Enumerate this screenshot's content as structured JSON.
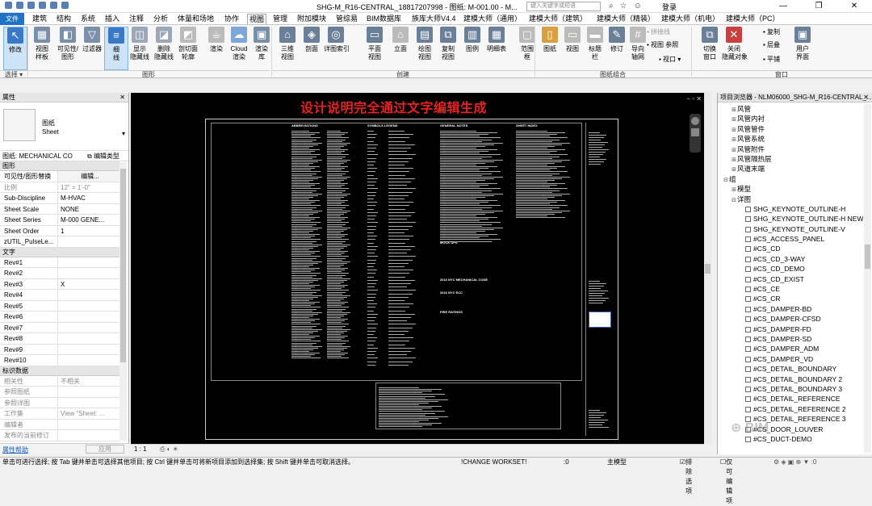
{
  "window": {
    "title": "SHG-M_R16-CENTRAL_18817207998 - 图纸: M-001.00 - M...",
    "search_placeholder": "键入关键字或短语",
    "login": "登录",
    "controls": [
      "—",
      "❐",
      "✕"
    ]
  },
  "tabs": [
    "建筑",
    "结构",
    "系统",
    "插入",
    "注释",
    "分析",
    "体量和场地",
    "协作",
    "视图",
    "管理",
    "附加模块",
    "管综易",
    "BIM数据库",
    "族库大师V4.4",
    "建模大师（通用）",
    "建模大师（建筑）",
    "建模大师（精装）",
    "建模大师（机电）",
    "建模大师（PC）"
  ],
  "active_tab": "视图",
  "file_tab": "文件",
  "ribbon": {
    "buttons": [
      {
        "label": "修改",
        "color": "#3a78c8",
        "glyph": "↖"
      },
      {
        "label": "视图\n样板",
        "color": "#7a8fa8",
        "glyph": "▦"
      },
      {
        "label": "可见性/\n图形",
        "color": "#7a8fa8",
        "glyph": "◧"
      },
      {
        "label": "过滤器",
        "color": "#7a8fa8",
        "glyph": "▽"
      },
      {
        "label": "细\n线",
        "color": "#3a78c8",
        "glyph": "≡"
      },
      {
        "label": "显示\n隐藏线",
        "color": "#9aa8b8",
        "glyph": "◫"
      },
      {
        "label": "删除\n隐藏线",
        "color": "#9aa8b8",
        "glyph": "◪"
      },
      {
        "label": "剖切面\n轮廓",
        "color": "#bbbbbb",
        "glyph": "◩"
      },
      {
        "label": "渲染",
        "color": "#bbbbbb",
        "glyph": "☕"
      },
      {
        "label": "Cloud\n渲染",
        "color": "#7ea6d8",
        "glyph": "☁"
      },
      {
        "label": "渲染\n库",
        "color": "#7a8fa8",
        "glyph": "▣"
      },
      {
        "label": "三维\n视图",
        "color": "#6a7f98",
        "glyph": "⌂"
      },
      {
        "label": "剖面",
        "color": "#6a7f98",
        "glyph": "◈"
      },
      {
        "label": "详图索引",
        "color": "#6a7f98",
        "glyph": "◎"
      },
      {
        "label": "平面\n视图",
        "color": "#6a7f98",
        "glyph": "▭"
      },
      {
        "label": "立面",
        "color": "#bbbbbb",
        "glyph": "⌂"
      },
      {
        "label": "绘图\n视图",
        "color": "#6a7f98",
        "glyph": "▤"
      },
      {
        "label": "复制\n视图",
        "color": "#6a7f98",
        "glyph": "⧉"
      },
      {
        "label": "图例",
        "color": "#6a7f98",
        "glyph": "▥"
      },
      {
        "label": "明细表",
        "color": "#6a7f98",
        "glyph": "▦"
      },
      {
        "label": "范围\n框",
        "color": "#bbbbbb",
        "glyph": "▢"
      },
      {
        "label": "图纸",
        "color": "#d8a040",
        "glyph": "▯"
      },
      {
        "label": "视图",
        "color": "#bbbbbb",
        "glyph": "▭"
      },
      {
        "label": "标题\n栏",
        "color": "#bbbbbb",
        "glyph": "▬"
      },
      {
        "label": "修订",
        "color": "#6a7f98",
        "glyph": "✎"
      },
      {
        "label": "导向\n轴网",
        "color": "#bbbbbb",
        "glyph": "#"
      },
      {
        "label": "切换\n窗口",
        "color": "#6a7f98",
        "glyph": "⧉"
      },
      {
        "label": "关闭\n隐藏对象",
        "color": "#c84040",
        "glyph": "✕"
      },
      {
        "label": "用户\n界面",
        "color": "#6a7f98",
        "glyph": "▣"
      }
    ],
    "small_buttons": [
      "拼接线",
      "视图 参照",
      "视口 ▾",
      "复制",
      "层叠",
      "平铺"
    ],
    "groups": [
      "选择 ▾",
      "图形",
      "创建",
      "图纸组合",
      "窗口"
    ]
  },
  "properties": {
    "header": "属性",
    "type_name": "图纸\nSheet",
    "type_selector": "图纸: MECHANICAL CO",
    "edit_type": "编辑类型",
    "sections": [
      {
        "title": "图形",
        "rows": [
          {
            "k": "可见性/图形替换",
            "v": "编辑...",
            "grey": false
          },
          {
            "k": "比例",
            "v": "12\" = 1'-0\"",
            "grey": true
          },
          {
            "k": "Sub-Discipline",
            "v": "M-HVAC",
            "grey": false
          },
          {
            "k": "Sheet Scale",
            "v": "NONE",
            "grey": false
          },
          {
            "k": "Sheet Series",
            "v": "M-000 GENE...",
            "grey": false
          },
          {
            "k": "Sheet Order",
            "v": "1",
            "grey": false
          },
          {
            "k": "zUTIL_PulseLe...",
            "v": "",
            "grey": false
          }
        ]
      },
      {
        "title": "文字",
        "rows": [
          {
            "k": "Rev#1",
            "v": "",
            "grey": false
          },
          {
            "k": "Rev#2",
            "v": "",
            "grey": false
          },
          {
            "k": "Rev#3",
            "v": "X",
            "grey": false
          },
          {
            "k": "Rev#4",
            "v": "",
            "grey": false
          },
          {
            "k": "Rev#5",
            "v": "",
            "grey": false
          },
          {
            "k": "Rev#6",
            "v": "",
            "grey": false
          },
          {
            "k": "Rev#7",
            "v": "",
            "grey": false
          },
          {
            "k": "Rev#8",
            "v": "",
            "grey": false
          },
          {
            "k": "Rev#9",
            "v": "",
            "grey": false
          },
          {
            "k": "Rev#10",
            "v": "",
            "grey": false
          }
        ]
      },
      {
        "title": "标识数据",
        "rows": [
          {
            "k": "相关性",
            "v": "不相关",
            "grey": true
          },
          {
            "k": "参照图纸",
            "v": "",
            "grey": true
          },
          {
            "k": "参照详图",
            "v": "",
            "grey": true
          },
          {
            "k": "工作集",
            "v": "View \"Sheet: ...",
            "grey": true
          },
          {
            "k": "编辑者",
            "v": "",
            "grey": true
          },
          {
            "k": "发布的当前修订",
            "v": "",
            "grey": true
          }
        ]
      }
    ],
    "help": "属性帮助",
    "apply": "应用"
  },
  "canvas": {
    "banner": "设计说明完全通过文字编辑生成",
    "column_heads": [
      "ABBREVIATIONS",
      "SYMBOLS LEGEND",
      "GENERAL NOTES",
      "SHEET INDEX"
    ],
    "sub_heads": [
      "MOCK UPS",
      "2016 NYC MECHANICAL CODE",
      "2016 NYC ECC",
      "FIRE RATINGS"
    ],
    "scale": "1 : 1"
  },
  "browser": {
    "header": "项目浏览器 - NLM06000_SHG-M_R16-CENTRAL_...",
    "items": [
      {
        "t": "风管",
        "lvl": 1,
        "exp": "⊞"
      },
      {
        "t": "风管内衬",
        "lvl": 1,
        "exp": "⊞"
      },
      {
        "t": "风管管件",
        "lvl": 1,
        "exp": "⊞"
      },
      {
        "t": "风管系统",
        "lvl": 1,
        "exp": "⊞"
      },
      {
        "t": "风管附件",
        "lvl": 1,
        "exp": "⊞"
      },
      {
        "t": "风管隔热层",
        "lvl": 1,
        "exp": "⊞"
      },
      {
        "t": "风道末端",
        "lvl": 1,
        "exp": "⊞"
      },
      {
        "t": "组",
        "lvl": 0,
        "exp": "⊟"
      },
      {
        "t": "模型",
        "lvl": 1,
        "exp": "⊞"
      },
      {
        "t": "详图",
        "lvl": 1,
        "exp": "⊟"
      },
      {
        "t": "SHG_KEYNOTE_OUTLINE-H",
        "lvl": 2,
        "exp": ""
      },
      {
        "t": "SHG_KEYNOTE_OUTLINE-H NEW",
        "lvl": 2,
        "exp": ""
      },
      {
        "t": "SHG_KEYNOTE_OUTLINE-V",
        "lvl": 2,
        "exp": ""
      },
      {
        "t": "#CS_ACCESS_PANEL",
        "lvl": 2,
        "exp": ""
      },
      {
        "t": "#CS_CD",
        "lvl": 2,
        "exp": ""
      },
      {
        "t": "#CS_CD_3-WAY",
        "lvl": 2,
        "exp": ""
      },
      {
        "t": "#CS_CD_DEMO",
        "lvl": 2,
        "exp": ""
      },
      {
        "t": "#CS_CD_EXIST",
        "lvl": 2,
        "exp": ""
      },
      {
        "t": "#CS_CE",
        "lvl": 2,
        "exp": ""
      },
      {
        "t": "#CS_CR",
        "lvl": 2,
        "exp": ""
      },
      {
        "t": "#CS_DAMPER-BD",
        "lvl": 2,
        "exp": ""
      },
      {
        "t": "#CS_DAMPER-CFSD",
        "lvl": 2,
        "exp": ""
      },
      {
        "t": "#CS_DAMPER-FD",
        "lvl": 2,
        "exp": ""
      },
      {
        "t": "#CS_DAMPER-SD",
        "lvl": 2,
        "exp": ""
      },
      {
        "t": "#CS_DAMPER_ADM",
        "lvl": 2,
        "exp": ""
      },
      {
        "t": "#CS_DAMPER_VD",
        "lvl": 2,
        "exp": ""
      },
      {
        "t": "#CS_DETAIL_BOUNDARY",
        "lvl": 2,
        "exp": ""
      },
      {
        "t": "#CS_DETAIL_BOUNDARY 2",
        "lvl": 2,
        "exp": ""
      },
      {
        "t": "#CS_DETAIL_BOUNDARY 3",
        "lvl": 2,
        "exp": ""
      },
      {
        "t": "#CS_DETAIL_REFERENCE",
        "lvl": 2,
        "exp": ""
      },
      {
        "t": "#CS_DETAIL_REFERENCE 2",
        "lvl": 2,
        "exp": ""
      },
      {
        "t": "#CS_DETAIL_REFERENCE 3",
        "lvl": 2,
        "exp": ""
      },
      {
        "t": "#CS_DOOR_LOUVER",
        "lvl": 2,
        "exp": ""
      },
      {
        "t": "#CS_DUCT-DEMO",
        "lvl": 2,
        "exp": ""
      }
    ]
  },
  "status": {
    "hint": "单击可进行选择; 按 Tab 键并单击可选择其他项目; 按 Ctrl 键并单击可将新项目添加到选择集; 按 Shift 键并单击可取消选择。",
    "workset": "!CHANGE WORKSET!",
    "zero": ":0",
    "model": "主模型",
    "exclude": "排除选项",
    "editable": "仅可编辑项"
  },
  "watermark": "BIM"
}
